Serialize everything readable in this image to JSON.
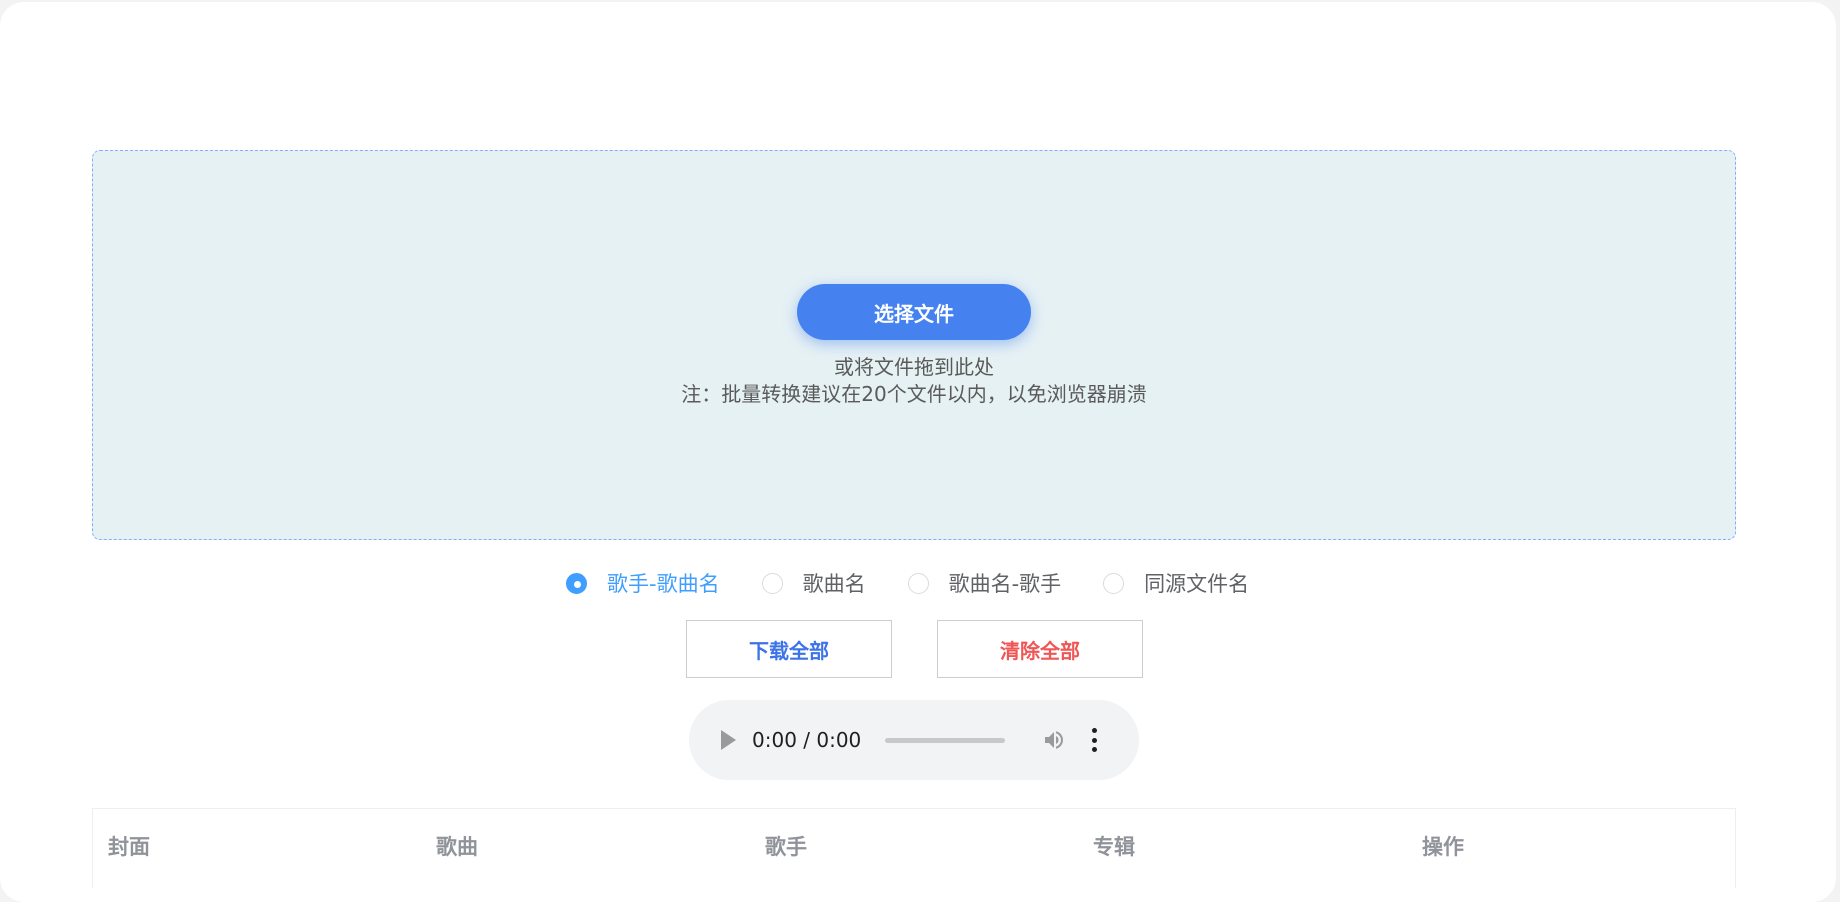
{
  "upload": {
    "button_label": "选择文件",
    "drag_hint": "或将文件拖到此处",
    "note": "注：批量转换建议在20个文件以内，以免浏览器崩溃"
  },
  "naming_options": {
    "selected": "歌手-歌曲名",
    "options": [
      "歌手-歌曲名",
      "歌曲名",
      "歌曲名-歌手",
      "同源文件名"
    ]
  },
  "actions": {
    "download_all": "下载全部",
    "clear_all": "清除全部"
  },
  "audio_player": {
    "time": "0:00 / 0:00"
  },
  "table": {
    "columns": [
      "封面",
      "歌曲",
      "歌手",
      "专辑",
      "操作"
    ]
  },
  "colors": {
    "primary": "#4582f0",
    "radio_active": "#409eff",
    "danger": "#f05656",
    "dropzone_bg": "#e6f1f4"
  }
}
